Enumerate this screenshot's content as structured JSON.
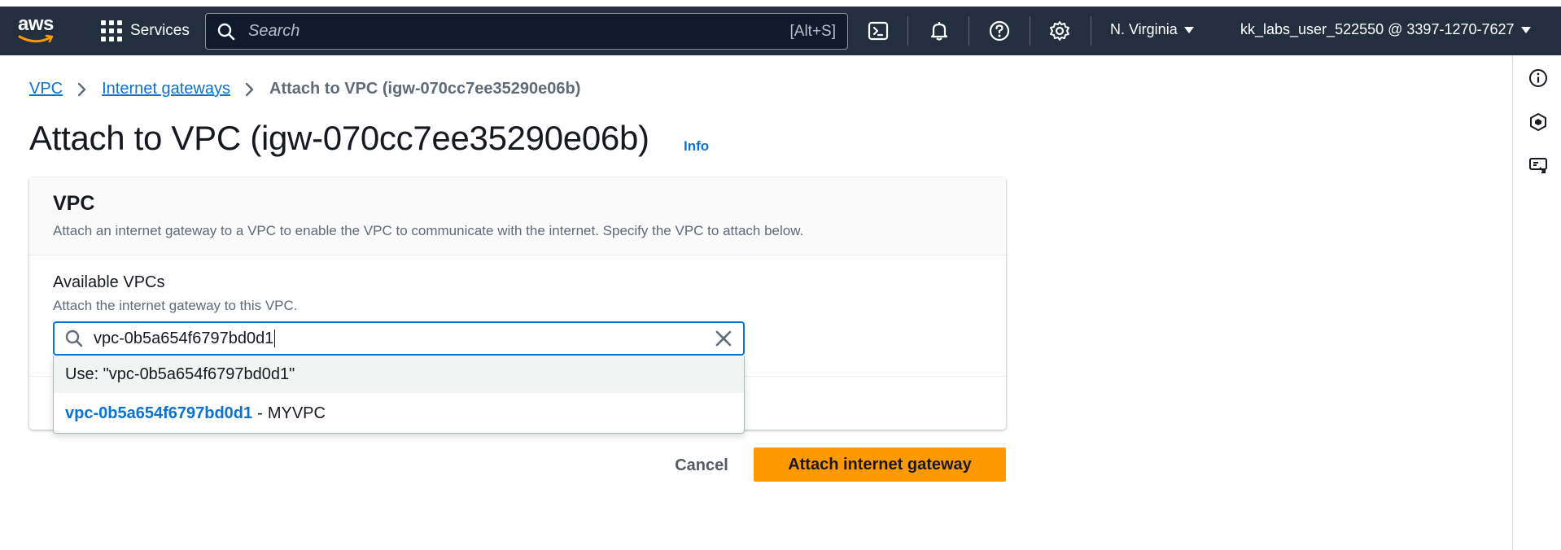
{
  "navbar": {
    "logo_text": "aws",
    "services_label": "Services",
    "search_placeholder": "Search",
    "search_shortcut": "[Alt+S]",
    "region": "N. Virginia",
    "account": "kk_labs_user_522550 @ 3397-1270-7627"
  },
  "breadcrumb": {
    "items": [
      "VPC",
      "Internet gateways"
    ],
    "current": "Attach to VPC (igw-070cc7ee35290e06b)"
  },
  "page": {
    "title": "Attach to VPC (igw-070cc7ee35290e06b)",
    "info_label": "Info"
  },
  "panel": {
    "title": "VPC",
    "description": "Attach an internet gateway to a VPC to enable the VPC to communicate with the internet. Specify the VPC to attach below.",
    "field_label": "Available VPCs",
    "field_description": "Attach the internet gateway to this VPC.",
    "input_value": "vpc-0b5a654f6797bd0d1"
  },
  "dropdown": {
    "use_option": "Use: \"vpc-0b5a654f6797bd0d1\"",
    "options": [
      {
        "id": "vpc-0b5a654f6797bd0d1",
        "separator": "-",
        "name": "MYVPC"
      }
    ]
  },
  "actions": {
    "cancel_label": "Cancel",
    "primary_label": "Attach internet gateway"
  },
  "colors": {
    "navbar_bg": "#232f3e",
    "link": "#0972d3",
    "primary": "#ff9900"
  },
  "icons": {
    "nav": [
      "cloudshell-icon",
      "bell-icon",
      "help-icon",
      "settings-icon"
    ],
    "rail": [
      "info-icon",
      "hexagon-icon",
      "feedback-icon"
    ]
  }
}
